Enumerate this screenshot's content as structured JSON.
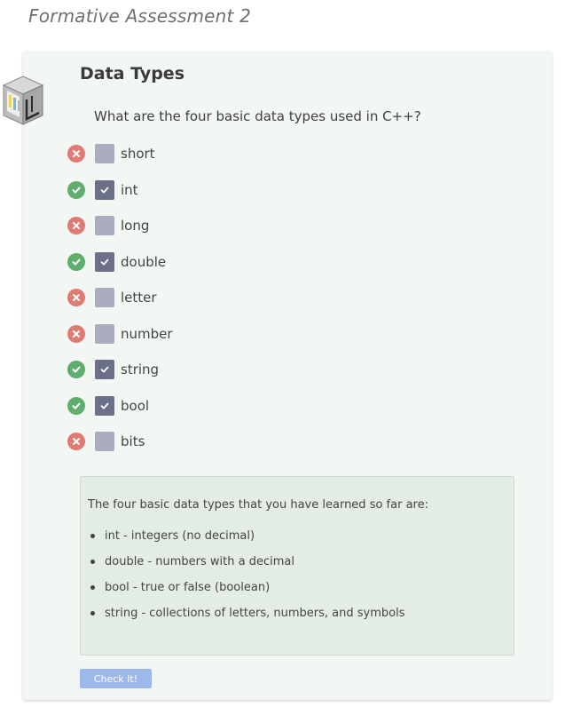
{
  "page": {
    "heading": "Formative Assessment 2"
  },
  "card": {
    "icon": "cube-module-icon",
    "title": "Data Types",
    "question": "What are the four basic data types used in C++?"
  },
  "options": [
    {
      "label": "short",
      "checked": false,
      "status": "wrong"
    },
    {
      "label": "int",
      "checked": true,
      "status": "correct"
    },
    {
      "label": "long",
      "checked": false,
      "status": "wrong"
    },
    {
      "label": "double",
      "checked": true,
      "status": "correct"
    },
    {
      "label": "letter",
      "checked": false,
      "status": "wrong"
    },
    {
      "label": "number",
      "checked": false,
      "status": "wrong"
    },
    {
      "label": "string",
      "checked": true,
      "status": "correct"
    },
    {
      "label": "bool",
      "checked": true,
      "status": "correct"
    },
    {
      "label": "bits",
      "checked": false,
      "status": "wrong"
    }
  ],
  "feedback": {
    "intro": "The four basic data types that you have learned so far are:",
    "items": [
      "int - integers (no decimal)",
      "double - numbers with a decimal",
      "bool - true or false (boolean)",
      "string - collections of letters, numbers, and symbols"
    ]
  },
  "actions": {
    "check_label": "Check It!"
  },
  "colors": {
    "correct": "#5fae6e",
    "wrong": "#e07b74",
    "checkbox_checked": "#6b6f87",
    "checkbox_unchecked": "#a9adbf",
    "button": "#9db8ea",
    "card_bg": "#f3f7f4",
    "feedback_bg": "#e3ede4"
  }
}
